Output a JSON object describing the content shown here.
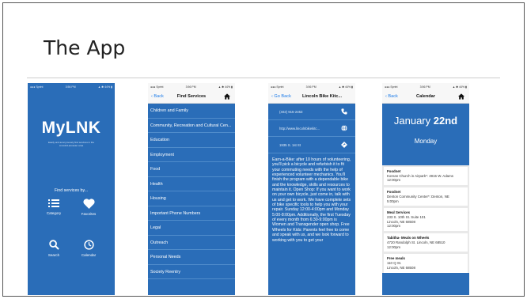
{
  "slide": {
    "title": "The App"
  },
  "status_bar": {
    "carrier": "●●● Sprint",
    "time": "3:56 PM",
    "battery": "▲ ✱ 44% ▮"
  },
  "phone1": {
    "logo": "MyLNK",
    "tagline": "Easily and anonymously find services in the Lincoln/Lancaster area",
    "find_label": "Find services by...",
    "buttons": [
      {
        "label": "Category",
        "icon": "list-icon"
      },
      {
        "label": "Favorites",
        "icon": "heart-icon"
      },
      {
        "label": "Search",
        "icon": "search-icon"
      },
      {
        "label": "Calendar",
        "icon": "clock-icon"
      }
    ]
  },
  "phone2": {
    "back": "‹ Back",
    "title": "Find Services",
    "items": [
      "Children and Family",
      "Community, Recreation and Cultural Cen...",
      "Education",
      "Employment",
      "Food",
      "Health",
      "Housing",
      "Important Phone Numbers",
      "Legal",
      "Outreach",
      "Personal Needs",
      "Society Reentry"
    ]
  },
  "phone3": {
    "back": "‹ Go Back",
    "title": "Lincoln Bike Kitc...",
    "contacts": [
      {
        "text": "(402) 915-2453",
        "icon": "phone-icon"
      },
      {
        "text": "http://www.lincolnbikekitc...",
        "icon": "globe-icon"
      },
      {
        "text": "1935 S. 1st St",
        "icon": "location-icon"
      }
    ],
    "description": "Earn-a-Bike: after 10 hours of volunteering, you'll pick a bicycle and refurbish it to fit your commuting needs with the help of experienced volunteer mechanics. You'll finish the program with a dependable bike and the knowledge, skills and resources to maintain it. Open Shop: If you want to work on your own bicycle, just come in, talk with us and get to work. We have complete sets of bike specific tools to help you with your repair. Sunday 12:00-4:00pm and Monday 5:00-8:00pm. Additionally, the first Tuesday of every month from 6:30-9:00pm is Women and Transgender open shop. Free Wheels for Kids: Parents feel free to come and speak with us, and we look forward to working with you to get your"
  },
  "phone4": {
    "back": "‹ Back",
    "title": "Calendar",
    "month": "January",
    "day": "22nd",
    "weekday": "Monday",
    "events": [
      {
        "title": "Foodnet",
        "location": "Korean Church in Airpark*: 4915 W. Adams",
        "time": "12:00pm"
      },
      {
        "title": "Foodnet",
        "location": "Denton Community Center*: Denton, NE",
        "time": "5:00pm"
      },
      {
        "title": "Meal Services",
        "location": "233 S. 10th St. Suite 101\nLincoln, NE 68508",
        "time": "12:00pm"
      },
      {
        "title": "Tabitha- Meals on Wheels",
        "location": "4720 Randolph St. Lincoln, NE 68510",
        "time": "12:00pm"
      },
      {
        "title": "Free meals",
        "location": "110 Q St.\nLincoln, NE 68508",
        "time": ""
      }
    ]
  },
  "colors": {
    "app_blue": "#2a6db8",
    "ios_link": "#1a7ae8"
  }
}
